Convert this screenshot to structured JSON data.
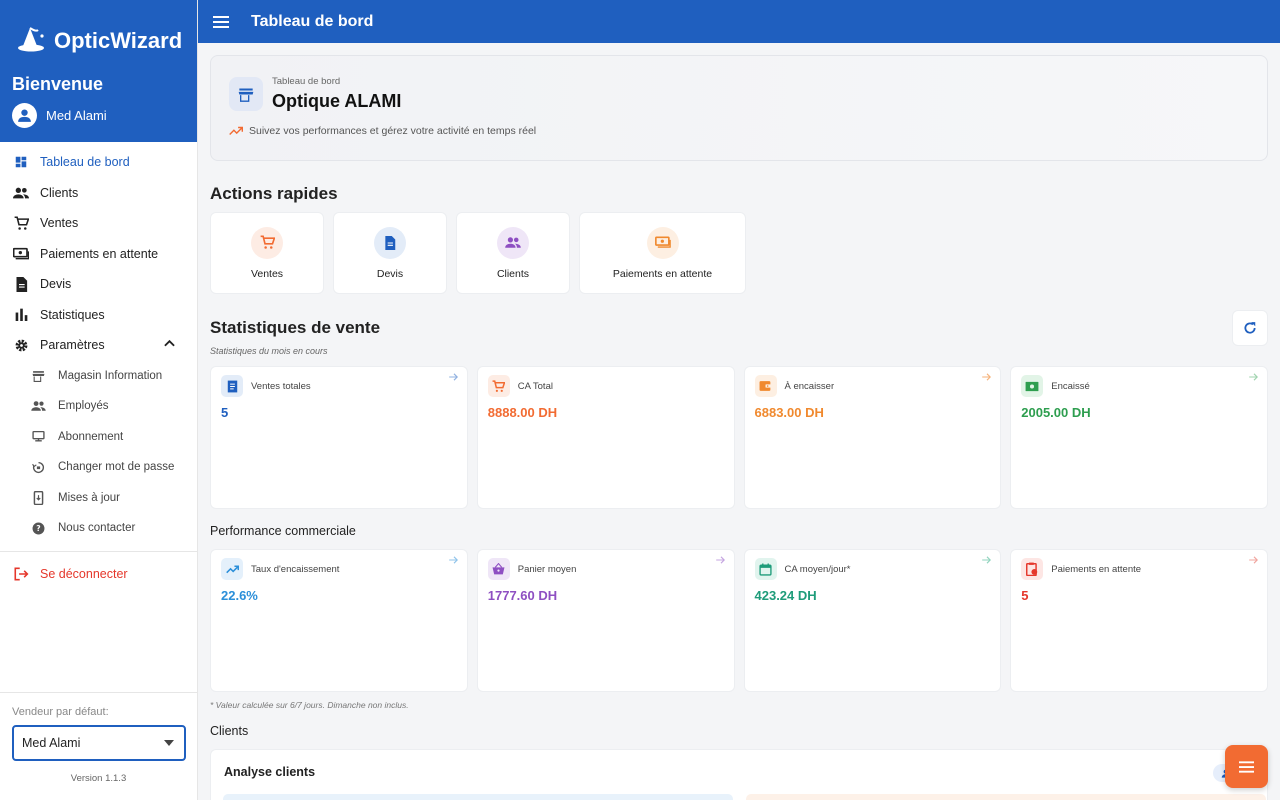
{
  "app": {
    "name": "OpticWizard",
    "page_title": "Tableau de bord"
  },
  "sidebar": {
    "welcome": "Bienvenue",
    "user": "Med Alami",
    "items": [
      {
        "label": "Tableau de bord",
        "icon": "dashboard-icon",
        "active": true
      },
      {
        "label": "Clients",
        "icon": "people-icon"
      },
      {
        "label": "Ventes",
        "icon": "cart-icon"
      },
      {
        "label": "Paiements en attente",
        "icon": "payments-icon"
      },
      {
        "label": "Devis",
        "icon": "document-icon"
      },
      {
        "label": "Statistiques",
        "icon": "bar-chart-icon"
      },
      {
        "label": "Paramètres",
        "icon": "gear-icon",
        "expanded": true
      }
    ],
    "sub_items": [
      {
        "label": "Magasin Information",
        "icon": "store-icon"
      },
      {
        "label": "Employés",
        "icon": "people-icon"
      },
      {
        "label": "Abonnement",
        "icon": "subscription-icon"
      },
      {
        "label": "Changer mot de passe",
        "icon": "lock-reset-icon"
      },
      {
        "label": "Mises à jour",
        "icon": "update-icon"
      },
      {
        "label": "Nous contacter",
        "icon": "help-icon"
      }
    ],
    "logout": "Se déconnecter",
    "default_seller_label": "Vendeur par défaut:",
    "default_seller_value": "Med Alami",
    "version": "Version 1.1.3"
  },
  "hero": {
    "small": "Tableau de bord",
    "title": "Optique ALAMI",
    "subtitle": "Suivez vos performances et gérez votre activité en temps réel"
  },
  "quick_actions": {
    "title": "Actions rapides",
    "items": [
      {
        "label": "Ventes",
        "icon": "cart-icon",
        "color": "#f26b32",
        "bg": "#fdece4"
      },
      {
        "label": "Devis",
        "icon": "document-icon",
        "color": "#1f5fbf",
        "bg": "#e3ecf8"
      },
      {
        "label": "Clients",
        "icon": "people-icon",
        "color": "#8e4fc2",
        "bg": "#efe6f7"
      },
      {
        "label": "Paiements en attente",
        "icon": "payments-icon",
        "color": "#f0892e",
        "bg": "#fdefe2"
      }
    ]
  },
  "sales_stats": {
    "title": "Statistiques de vente",
    "subtitle": "Statistiques du mois en cours",
    "cards": [
      {
        "label": "Ventes totales",
        "value": "5",
        "color": "#1f5fbf",
        "icon": "receipt-icon"
      },
      {
        "label": "CA Total",
        "value": "8888.00 DH",
        "color": "#f26b32",
        "icon": "cart-icon"
      },
      {
        "label": "À encaisser",
        "value": "6883.00 DH",
        "color": "#f0892e",
        "icon": "wallet-icon"
      },
      {
        "label": "Encaissé",
        "value": "2005.00 DH",
        "color": "#2e9e4f",
        "icon": "cash-icon"
      }
    ]
  },
  "performance": {
    "title": "Performance commerciale",
    "cards": [
      {
        "label": "Taux d'encaissement",
        "value": "22.6%",
        "color": "#2b8fd9",
        "icon": "trending-up-icon"
      },
      {
        "label": "Panier moyen",
        "value": "1777.60 DH",
        "color": "#8e4fc2",
        "icon": "basket-icon"
      },
      {
        "label": "CA moyen/jour*",
        "value": "423.24 DH",
        "color": "#1f9c7a",
        "icon": "calendar-icon"
      },
      {
        "label": "Paiements en attente",
        "value": "5",
        "color": "#e5372b",
        "icon": "pending-icon"
      }
    ],
    "footnote": "* Valeur calculée sur 6/7 jours. Dimanche non inclus."
  },
  "clients": {
    "title": "Clients",
    "analysis_title": "Analyse clients",
    "badge": "2 c"
  }
}
